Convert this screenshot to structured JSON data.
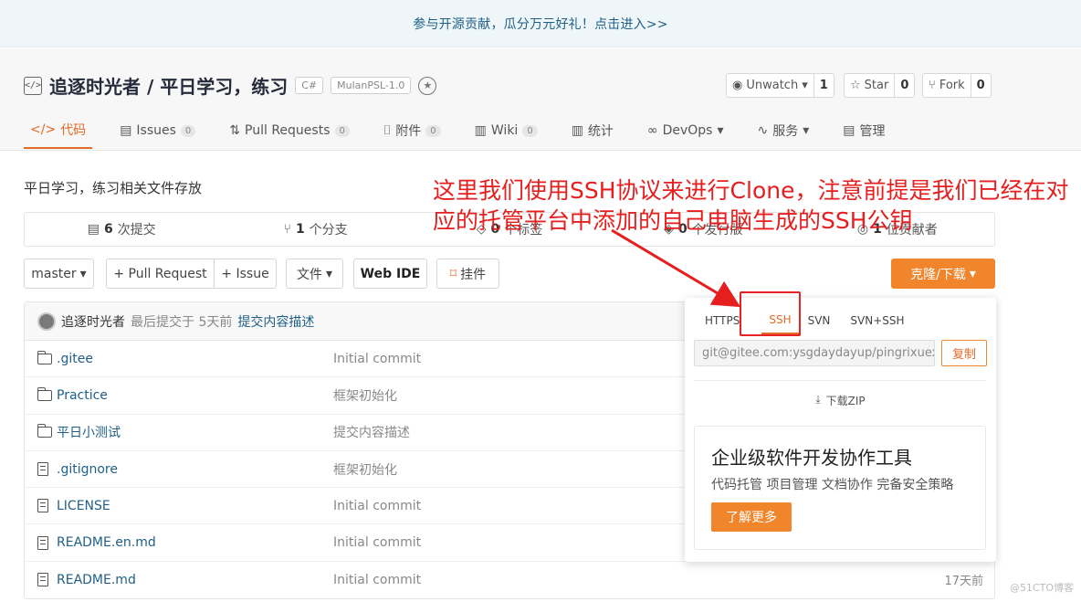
{
  "banner": {
    "text": "参与开源贡献，瓜分万元好礼！点击进入>>"
  },
  "repo": {
    "title": "追逐时光者 / 平日学习，练习",
    "tags": [
      "C#",
      "MulanPSL-1.0"
    ],
    "actions": [
      {
        "label": "Unwatch",
        "count": "1",
        "icon": "eye-icon"
      },
      {
        "label": "Star",
        "count": "0",
        "icon": "star-icon"
      },
      {
        "label": "Fork",
        "count": "0",
        "icon": "fork-icon"
      }
    ]
  },
  "tabs": [
    {
      "label": "代码",
      "icon": "code-icon",
      "active": true
    },
    {
      "label": "Issues",
      "count": "0",
      "icon": "issues-icon"
    },
    {
      "label": "Pull Requests",
      "count": "0",
      "icon": "pull-request-icon"
    },
    {
      "label": "附件",
      "count": "0",
      "icon": "attachment-icon"
    },
    {
      "label": "Wiki",
      "count": "0",
      "icon": "wiki-icon"
    },
    {
      "label": "统计",
      "icon": "stats-icon"
    },
    {
      "label": "DevOps",
      "icon": "devops-icon"
    },
    {
      "label": "服务",
      "icon": "service-icon"
    },
    {
      "label": "管理",
      "icon": "manage-icon"
    }
  ],
  "description": "平日学习，练习相关文件存放",
  "stats": {
    "commits_num": "6",
    "commits_label": "次提交",
    "branches_num": "1",
    "branches_label": "个分支",
    "tags_num": "0",
    "tags_label": "个标签",
    "releases_num": "0",
    "releases_label": "个发行版",
    "contrib_num": "1",
    "contrib_label": "位贡献者"
  },
  "toolbar": {
    "branch": "master",
    "pull_request": "+ Pull Request",
    "issue": "+ Issue",
    "file": "文件",
    "web_ide": "Web IDE",
    "pin": "挂件",
    "clone": "克隆/下载"
  },
  "last_commit": {
    "author": "追逐时光者",
    "meta": "最后提交于 5天前",
    "message": "提交内容描述"
  },
  "files": [
    {
      "type": "folder",
      "name": ".gitee",
      "message": "Initial commit",
      "time": ""
    },
    {
      "type": "folder",
      "name": "Practice",
      "message": "框架初始化",
      "time": ""
    },
    {
      "type": "folder",
      "name": "平日小测试",
      "message": "提交内容描述",
      "time": ""
    },
    {
      "type": "file",
      "name": ".gitignore",
      "message": "框架初始化",
      "time": ""
    },
    {
      "type": "file",
      "name": "LICENSE",
      "message": "Initial commit",
      "time": ""
    },
    {
      "type": "file",
      "name": "README.en.md",
      "message": "Initial commit",
      "time": ""
    },
    {
      "type": "file",
      "name": "README.md",
      "message": "Initial commit",
      "time": "17天前"
    }
  ],
  "clone_panel": {
    "protocols": [
      "HTTPS",
      "SSH",
      "SVN",
      "SVN+SSH"
    ],
    "active_protocol": "SSH",
    "url": "git@gitee.com:ysgdaydayup/pingrixuexi.git",
    "copy": "复制",
    "download_zip": "下载ZIP",
    "enterprise_title": "企业级软件开发协作工具",
    "enterprise_sub": "代码托管 项目管理 文档协作 完备安全策略",
    "enterprise_btn": "了解更多"
  },
  "annotation": "这里我们使用SSH协议来进行Clone，注意前提是我们已经在对应的托管平台中添加的自己电脑生成的SSH公钥",
  "watermark": "@51CTO博客",
  "colors": {
    "accent": "#f0852c",
    "link": "#1f5f86",
    "annotation": "#e61e1e"
  }
}
